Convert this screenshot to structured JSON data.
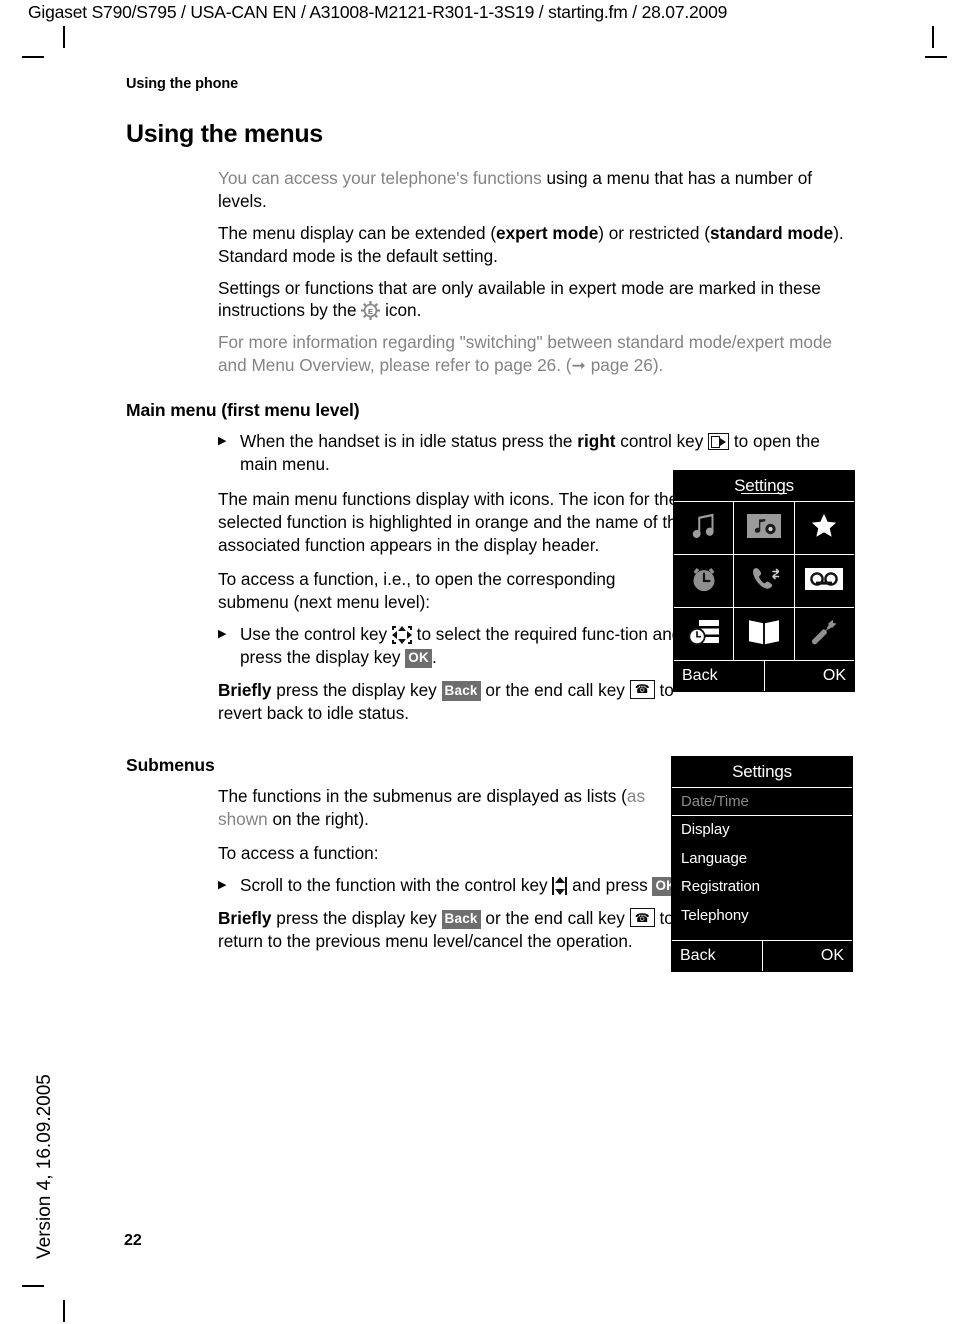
{
  "header": {
    "running_head": "Gigaset S790/S795 / USA-CAN EN / A31008-M2121-R301-1-3S19 / starting.fm / 28.07.2009"
  },
  "sidebar": {
    "version_text": "Version 4, 16.09.2005"
  },
  "footer": {
    "page_number": "22"
  },
  "content": {
    "chapter_title": "Using the phone",
    "section_title": "Using the menus",
    "para_1_gray": "You can access your telephone's functions ",
    "para_1_black": "using a menu that has a number of levels.",
    "para_2_a": "The menu display can be extended (",
    "para_2_b": "expert mode",
    "para_2_c": ") or restricted (",
    "para_2_d": "standard mode",
    "para_2_e": "). Standard mode is the default setting.",
    "para_3_a": "Settings or functions that are only available in expert mode are marked in these instructions by the ",
    "para_3_b": " icon.",
    "para_4": "For more information regarding \"switching\" between standard mode/expert mode and Menu Overview, please refer to page 26. (",
    "para_4_ref": " page 26).",
    "main_menu": {
      "heading": "Main menu (first menu level)",
      "bullet_a": "When the handset is in idle status press the ",
      "bullet_b": "right",
      "bullet_c": " control key ",
      "bullet_d": " to open the main menu.",
      "para_a": "The main menu functions display with icons. The icon for the selected function is highlighted in orange and the name of the associated function appears in the display header.",
      "para_b": "To access a function, i.e., to open the corresponding submenu (next menu level):",
      "bullet2_a": "Use the control key ",
      "bullet2_b": " to select the required func-tion and press the display key ",
      "bullet2_key": "OK",
      "bullet2_c": ".",
      "briefly_a": "Briefly",
      "briefly_b": " press the display key ",
      "briefly_key": "Back",
      "briefly_c": " or the end call key ",
      "briefly_d": " to revert back to idle status."
    },
    "submenus": {
      "heading": "Submenus",
      "para_a": "The functions in the submenus are displayed as lists (",
      "para_a_gray": "as shown",
      "para_a_end": " on the right).",
      "para_b": "To access a function:",
      "bullet_a": "Scroll to the function with the control key ",
      "bullet_b": " and press ",
      "bullet_key": "OK",
      "bullet_c": ".",
      "briefly_a": "Briefly",
      "briefly_b": " press the display key ",
      "briefly_key": "Back",
      "briefly_c": " or the end call key ",
      "briefly_d": " to return to the previous menu level/cancel the operation."
    }
  },
  "main_menu_display": {
    "title": "Settings",
    "icons": [
      {
        "name": "music-note-icon",
        "label": "Sound Settings"
      },
      {
        "name": "media-folder-icon",
        "label": "Media Pool"
      },
      {
        "name": "star-icon",
        "label": "Additional Features"
      },
      {
        "name": "alarm-clock-icon",
        "label": "Organizer"
      },
      {
        "name": "call-lists-icon",
        "label": "Call Lists"
      },
      {
        "name": "answering-machine-icon",
        "label": "Voice Mail"
      },
      {
        "name": "messaging-icon",
        "label": "Messaging"
      },
      {
        "name": "directory-book-icon",
        "label": "Directory"
      },
      {
        "name": "wrench-settings-icon",
        "label": "Settings"
      }
    ],
    "softkey_left": "Back",
    "softkey_right": "OK"
  },
  "submenu_display": {
    "title": "Settings",
    "items": [
      {
        "label": "Date/Time",
        "selected": true
      },
      {
        "label": "Display",
        "selected": false
      },
      {
        "label": "Language",
        "selected": false
      },
      {
        "label": "Registration",
        "selected": false
      },
      {
        "label": "Telephony",
        "selected": false
      }
    ],
    "softkey_left": "Back",
    "softkey_right": "OK"
  },
  "colors": {
    "display_bg": "#000000",
    "display_fg": "#ffffff",
    "gray_text": "#848484",
    "softkey_bg": "#6e6e6e"
  }
}
